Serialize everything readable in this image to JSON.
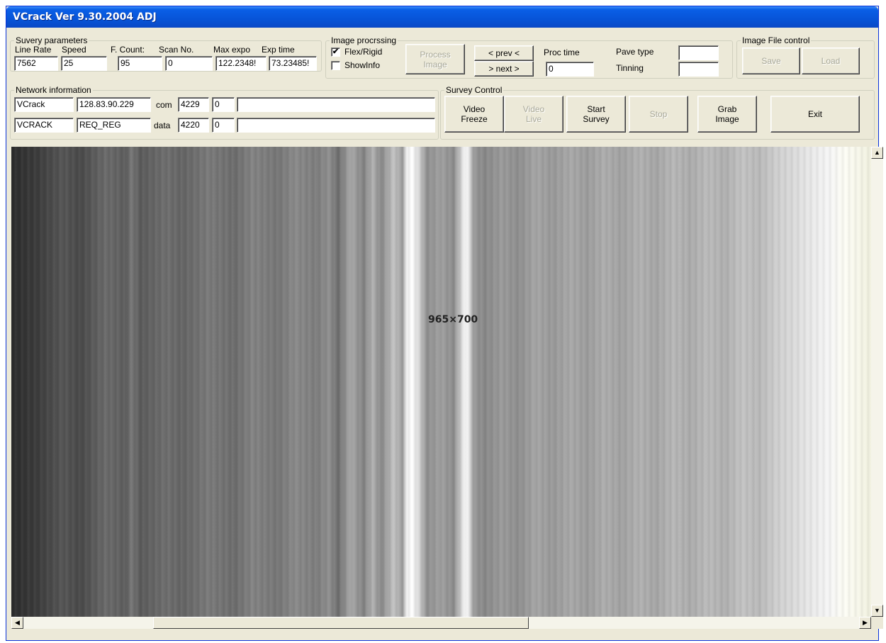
{
  "window": {
    "title": "VCrack Ver 9.30.2004 ADJ"
  },
  "survey_params": {
    "legend": "Suvery parameters",
    "labels": [
      "Line Rate",
      "Speed",
      "F. Count:",
      "Scan No.",
      "Max expo",
      "Exp time"
    ],
    "values": [
      "7562",
      "25",
      "95",
      "0",
      "122.2348!",
      "73.23485!"
    ]
  },
  "image_processing": {
    "legend": "Image procrssing",
    "flex_rigid": {
      "label": "Flex/Rigid",
      "checked": true,
      "mark": "✔"
    },
    "show_info": {
      "label": "ShowInfo",
      "checked": false
    },
    "process_button": "Process\nImage",
    "prev_button": "< prev <",
    "next_button": "> next >",
    "proc_time_label": "Proc time",
    "proc_time_value": "0",
    "pave_type_label": "Pave type",
    "pave_type_value": "",
    "tinning_label": "Tinning",
    "tinning_value": ""
  },
  "image_file_control": {
    "legend": "Image File control",
    "save_button": "Save",
    "load_button": "Load"
  },
  "network": {
    "legend": "Network information",
    "rows": [
      {
        "name": "VCrack",
        "address": "128.83.90.229",
        "channel": "com",
        "port": "4229",
        "count": "0",
        "message": ""
      },
      {
        "name": "VCRACK",
        "address": "REQ_REG",
        "channel": "data",
        "port": "4220",
        "count": "0",
        "message": ""
      }
    ]
  },
  "survey_control": {
    "legend": "Survey Control",
    "video_freeze": "Video\nFreeze",
    "video_live": "Video\nLive",
    "start_survey": "Start\nSurvey",
    "stop": "Stop",
    "grab_image": "Grab\nImage",
    "exit": "Exit"
  },
  "viewer": {
    "dimensions_label": "965×700",
    "scrollbars": {
      "up_icon": "scroll-up-arrow-icon",
      "down_icon": "scroll-down-arrow-icon",
      "left_icon": "scroll-left-arrow-icon",
      "right_icon": "scroll-right-arrow-icon"
    }
  },
  "colors": {
    "title_bar": "#0754d8",
    "window_face": "#ece9d8",
    "disabled_text": "#a8a898"
  }
}
